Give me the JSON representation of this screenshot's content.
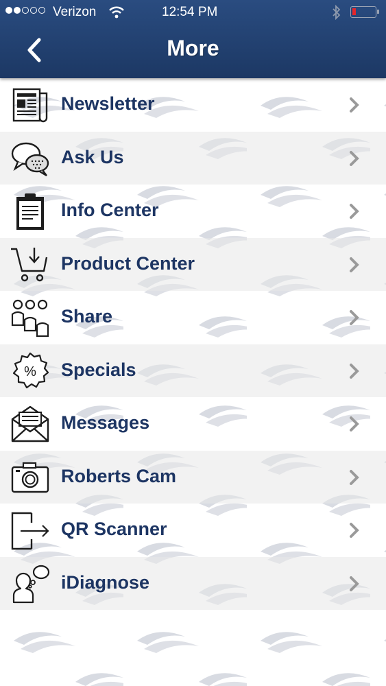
{
  "status_bar": {
    "carrier": "Verizon",
    "time": "12:54 PM"
  },
  "header": {
    "title": "More"
  },
  "menu": [
    {
      "label": "Newsletter",
      "icon": "newspaper-icon"
    },
    {
      "label": "Ask Us",
      "icon": "chat-bubbles-icon"
    },
    {
      "label": "Info Center",
      "icon": "clipboard-icon"
    },
    {
      "label": "Product Center",
      "icon": "shopping-cart-icon"
    },
    {
      "label": "Share",
      "icon": "people-group-icon"
    },
    {
      "label": "Specials",
      "icon": "percent-badge-icon"
    },
    {
      "label": "Messages",
      "icon": "envelope-icon"
    },
    {
      "label": "Roberts Cam",
      "icon": "camera-icon"
    },
    {
      "label": "QR Scanner",
      "icon": "exit-door-icon"
    },
    {
      "label": "iDiagnose",
      "icon": "thinking-person-icon"
    }
  ],
  "colors": {
    "header": "#1f3b6a",
    "label": "#1d3563",
    "chevron": "#9a9a9a"
  }
}
